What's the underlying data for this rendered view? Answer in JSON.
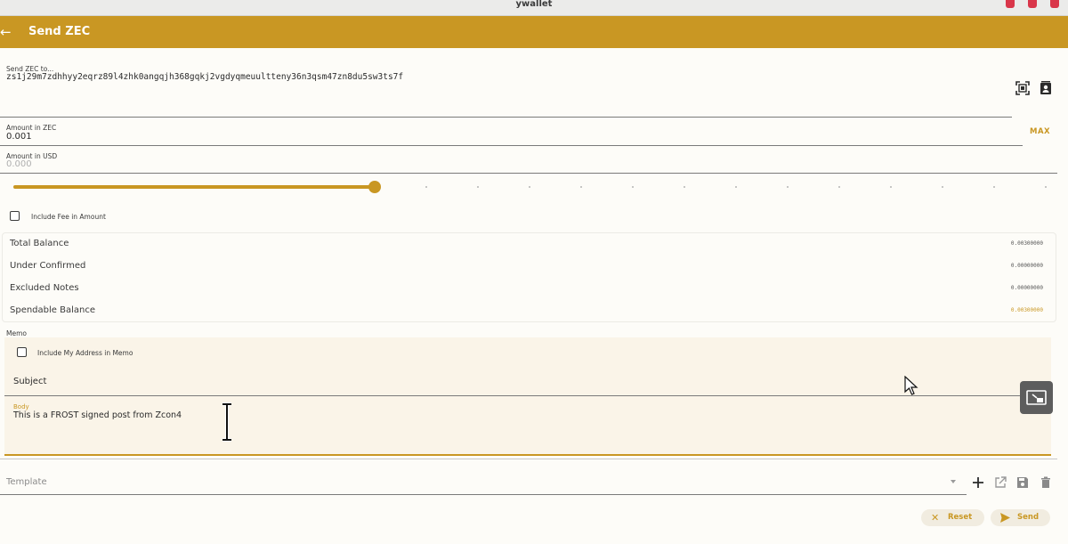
{
  "window": {
    "title": "ywallet"
  },
  "appbar": {
    "title": "Send ZEC"
  },
  "recipient": {
    "label": "Send ZEC to...",
    "value": "zs1j29m7zdhhyy2eqrz89l4zhk0angqjh368gqkj2vgdyqmeuultteny36n3qsm47zn8du5sw3ts7f"
  },
  "amount_zec": {
    "label": "Amount in ZEC",
    "value": "0.001",
    "max_label": "MAX"
  },
  "amount_usd": {
    "label": "Amount in USD",
    "value": "0.000"
  },
  "slider": {
    "fraction": 0.35
  },
  "include_fee": {
    "label": "Include Fee in Amount",
    "checked": false
  },
  "balances": [
    {
      "name": "Total Balance",
      "amount": "0.00300000"
    },
    {
      "name": "Under Confirmed",
      "amount": "0.00000000"
    },
    {
      "name": "Excluded Notes",
      "amount": "0.00000000"
    },
    {
      "name": "Spendable Balance",
      "amount": "0.00300000"
    }
  ],
  "memo": {
    "label": "Memo",
    "include_address_label": "Include My Address in Memo",
    "subject_placeholder": "Subject",
    "body_label": "Body",
    "body_value": "This is a FROST signed post from Zcon4"
  },
  "template": {
    "placeholder": "Template"
  },
  "actions": {
    "reset_label": "Reset",
    "send_label": "Send"
  },
  "colors": {
    "accent": "#c99723",
    "appbar": "#c99723",
    "close": "#d9364a"
  }
}
